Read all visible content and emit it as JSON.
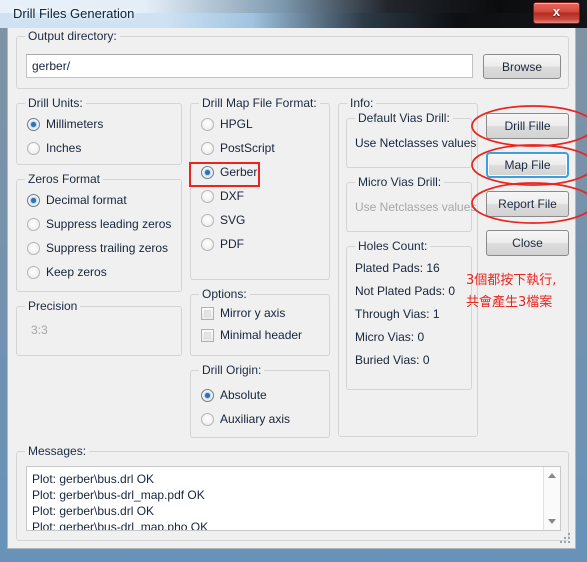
{
  "window": {
    "title": "Drill Files Generation",
    "close_label": "×",
    "close_glyph": "x"
  },
  "output_directory": {
    "group_label": "Output directory:",
    "value": "gerber/",
    "browse_label": "Browse"
  },
  "drill_units": {
    "group_label": "Drill Units:",
    "options": [
      {
        "label": "Millimeters",
        "selected": true
      },
      {
        "label": "Inches",
        "selected": false
      }
    ]
  },
  "zeros_format": {
    "group_label": "Zeros Format",
    "options": [
      {
        "label": "Decimal format",
        "selected": true
      },
      {
        "label": "Suppress leading zeros",
        "selected": false
      },
      {
        "label": "Suppress trailing zeros",
        "selected": false
      },
      {
        "label": "Keep zeros",
        "selected": false
      }
    ]
  },
  "precision": {
    "group_label": "Precision",
    "value": "3:3"
  },
  "drill_map_file_format": {
    "group_label": "Drill Map File Format:",
    "options": [
      {
        "label": "HPGL",
        "selected": false
      },
      {
        "label": "PostScript",
        "selected": false
      },
      {
        "label": "Gerber",
        "selected": true
      },
      {
        "label": "DXF",
        "selected": false
      },
      {
        "label": "SVG",
        "selected": false
      },
      {
        "label": "PDF",
        "selected": false
      }
    ]
  },
  "options": {
    "group_label": "Options:",
    "items": [
      {
        "label": "Mirror y axis",
        "checked": false
      },
      {
        "label": "Minimal header",
        "checked": false
      }
    ]
  },
  "drill_origin": {
    "group_label": "Drill Origin:",
    "options": [
      {
        "label": "Absolute",
        "selected": true
      },
      {
        "label": "Auxiliary axis",
        "selected": false
      }
    ]
  },
  "info": {
    "group_label": "Info:",
    "default_vias_drill": {
      "label": "Default Vias Drill:",
      "value": "Use Netclasses values"
    },
    "micro_vias_drill": {
      "label": "Micro Vias Drill:",
      "value": "Use Netclasses values"
    }
  },
  "holes_count": {
    "group_label": "Holes Count:",
    "rows": [
      {
        "label": "Plated Pads:",
        "value": "16",
        "text": "Plated Pads: 16"
      },
      {
        "label": "Not Plated Pads:",
        "value": "0",
        "text": "Not Plated Pads: 0"
      },
      {
        "label": "Through Vias:",
        "value": "1",
        "text": "Through Vias: 1"
      },
      {
        "label": "Micro Vias:",
        "value": "0",
        "text": "Micro Vias: 0"
      },
      {
        "label": "Buried Vias:",
        "value": "0",
        "text": "Buried Vias: 0"
      }
    ]
  },
  "action_buttons": [
    {
      "label": "Drill Fille",
      "focused": false,
      "annotated": true
    },
    {
      "label": "Map File",
      "focused": true,
      "annotated": true
    },
    {
      "label": "Report File",
      "focused": false,
      "annotated": true
    },
    {
      "label": "Close",
      "focused": false,
      "annotated": false
    }
  ],
  "messages": {
    "group_label": "Messages:",
    "lines": [
      "Plot: gerber\\bus.drl OK",
      "Plot: gerber\\bus-drl_map.pdf OK",
      "Plot: gerber\\bus.drl OK",
      "Plot: gerber\\bus-drl_map.pho OK"
    ]
  },
  "annotations": {
    "color": "#e8251f",
    "note_line1": "3個都按下執行,",
    "note_line2": "共會產生3檔案"
  }
}
